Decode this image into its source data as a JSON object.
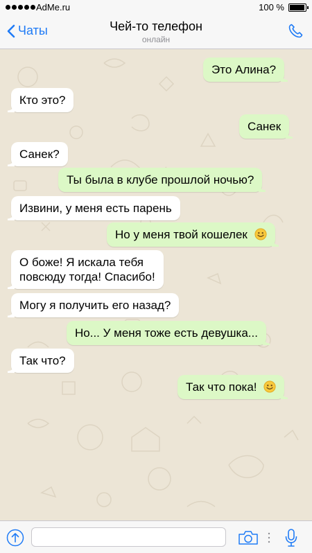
{
  "status_bar": {
    "carrier": "AdMe.ru",
    "battery_percent": "100 %"
  },
  "header": {
    "back_label": "Чаты",
    "title": "Чей-то телефон",
    "subtitle": "онлайн"
  },
  "messages": [
    {
      "direction": "outgoing",
      "text": "Это Алина?"
    },
    {
      "direction": "incoming",
      "text": "Кто это?"
    },
    {
      "direction": "outgoing",
      "text": "Санек"
    },
    {
      "direction": "incoming",
      "text": "Санек?"
    },
    {
      "direction": "outgoing",
      "text": "Ты была в клубе прошлой ночью?"
    },
    {
      "direction": "incoming",
      "text": "Извини, у меня есть парень"
    },
    {
      "direction": "outgoing",
      "text": "Но у меня твой кошелек",
      "emoji": "smiley-icon"
    },
    {
      "direction": "incoming",
      "text_line1": "О боже! Я искала тебя",
      "text_line2": "повсюду тогда! Спасибо!"
    },
    {
      "direction": "incoming",
      "text": "Могу я получить его назад?"
    },
    {
      "direction": "outgoing",
      "text": "Но... У меня тоже есть девушка..."
    },
    {
      "direction": "incoming",
      "text": "Так что?"
    },
    {
      "direction": "outgoing",
      "text": "Так что пока!",
      "emoji": "smiley-icon"
    }
  ],
  "input": {
    "value": "",
    "placeholder": ""
  },
  "colors": {
    "accent": "#1f7bf6",
    "chat_background": "#ece5d6",
    "outgoing_bubble": "#dcf8c6",
    "incoming_bubble": "#ffffff"
  }
}
